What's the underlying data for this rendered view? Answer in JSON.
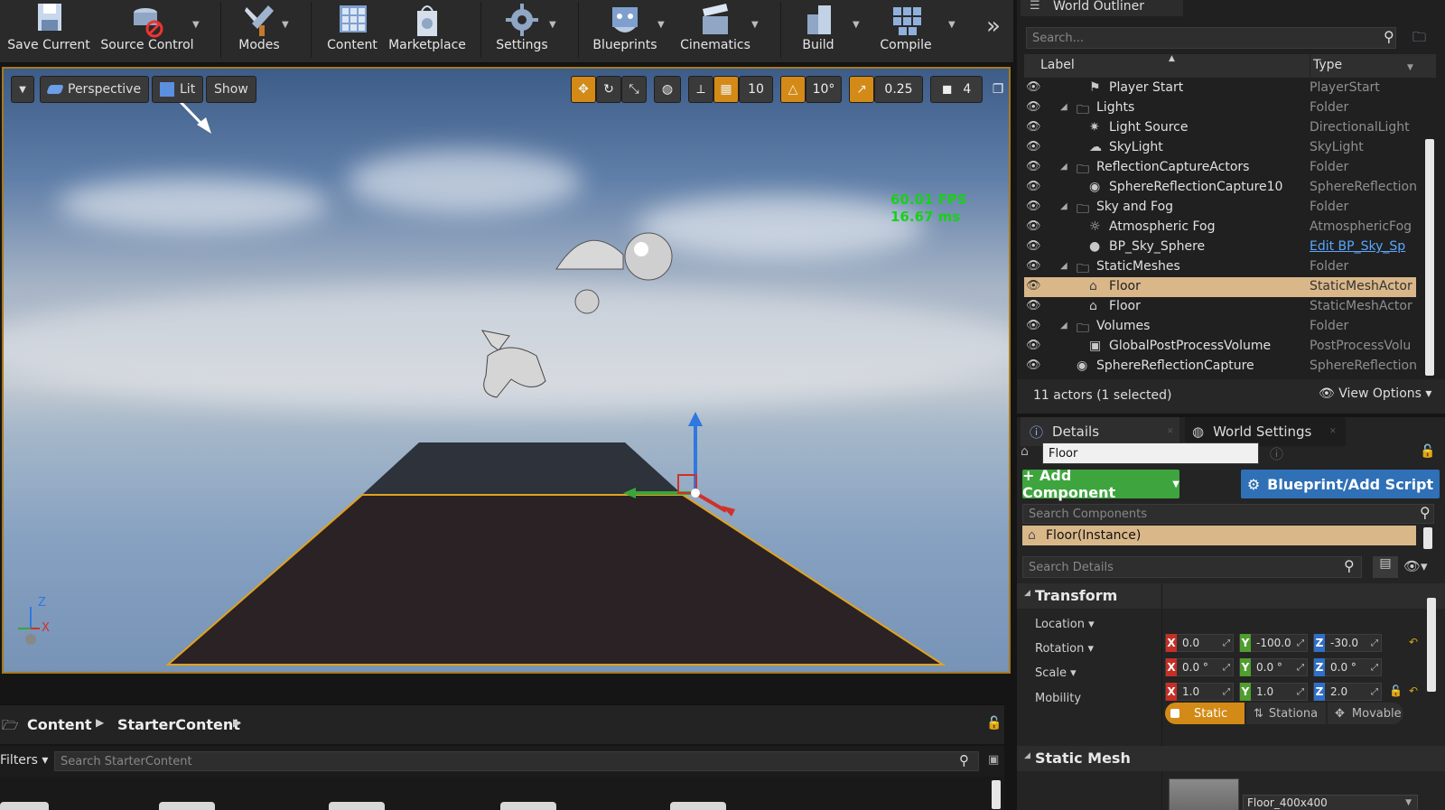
{
  "toolbar": {
    "save_current": "Save Current",
    "source_control": "Source Control",
    "modes": "Modes",
    "content": "Content",
    "marketplace": "Marketplace",
    "settings": "Settings",
    "blueprints": "Blueprints",
    "cinematics": "Cinematics",
    "build": "Build",
    "compile": "Compile"
  },
  "viewport": {
    "perspective": "Perspective",
    "lit": "Lit",
    "show": "Show",
    "grid_snap": "10",
    "rotation_snap": "10°",
    "scale_snap": "0.25",
    "camera_speed": "4",
    "fps": "60.01 FPS",
    "ms": "16.67 ms",
    "axis_z": "Z",
    "axis_x": "X"
  },
  "content_browser": {
    "breadcrumb": [
      "Content",
      "StarterContent"
    ],
    "filters": "Filters",
    "search_placeholder": "Search StarterContent"
  },
  "outliner": {
    "tab": "World Outliner",
    "search_placeholder": "Search...",
    "col_label": "Label",
    "col_type": "Type",
    "rows": [
      {
        "label": "Player Start",
        "type": "PlayerStart"
      },
      {
        "label": "Lights",
        "type": "Folder"
      },
      {
        "label": "Light Source",
        "type": "DirectionalLight"
      },
      {
        "label": "SkyLight",
        "type": "SkyLight"
      },
      {
        "label": "ReflectionCaptureActors",
        "type": "Folder"
      },
      {
        "label": "SphereReflectionCapture10",
        "type": "SphereReflection("
      },
      {
        "label": "Sky and Fog",
        "type": "Folder"
      },
      {
        "label": "Atmospheric Fog",
        "type": "AtmosphericFog"
      },
      {
        "label": "BP_Sky_Sphere",
        "type": "Edit BP_Sky_Sp"
      },
      {
        "label": "StaticMeshes",
        "type": "Folder"
      },
      {
        "label": "Floor",
        "type": "StaticMeshActor"
      },
      {
        "label": "Floor",
        "type": "StaticMeshActor"
      },
      {
        "label": "Volumes",
        "type": "Folder"
      },
      {
        "label": "GlobalPostProcessVolume",
        "type": "PostProcessVolu"
      },
      {
        "label": "SphereReflectionCapture",
        "type": "SphereReflection("
      }
    ],
    "actor_count": "11 actors (1 selected)",
    "view_options": "View Options"
  },
  "details": {
    "tab_details": "Details",
    "tab_world_settings": "World Settings",
    "name": "Floor",
    "add_component": "+ Add Component",
    "blueprint_script": "Blueprint/Add Script",
    "search_components": "Search Components",
    "instance": "Floor(Instance)",
    "search_details": "Search Details",
    "transform": "Transform",
    "location_label": "Location",
    "rotation_label": "Rotation",
    "scale_label": "Scale",
    "mobility_label": "Mobility",
    "location": {
      "x": "0.0",
      "y": "-100.0",
      "z": "-30.0"
    },
    "rotation": {
      "x": "0.0 °",
      "y": "0.0 °",
      "z": "0.0 °"
    },
    "scale": {
      "x": "1.0",
      "y": "1.0",
      "z": "2.0"
    },
    "mobility_static": "Static",
    "mobility_stationary": "Stationa",
    "mobility_movable": "Movable",
    "static_mesh_section": "Static Mesh",
    "static_mesh_value": "Floor_400x400"
  },
  "colors": {
    "selection": "#d9b789",
    "accent_orange": "#d38a16",
    "fps_green": "#19d01a"
  }
}
